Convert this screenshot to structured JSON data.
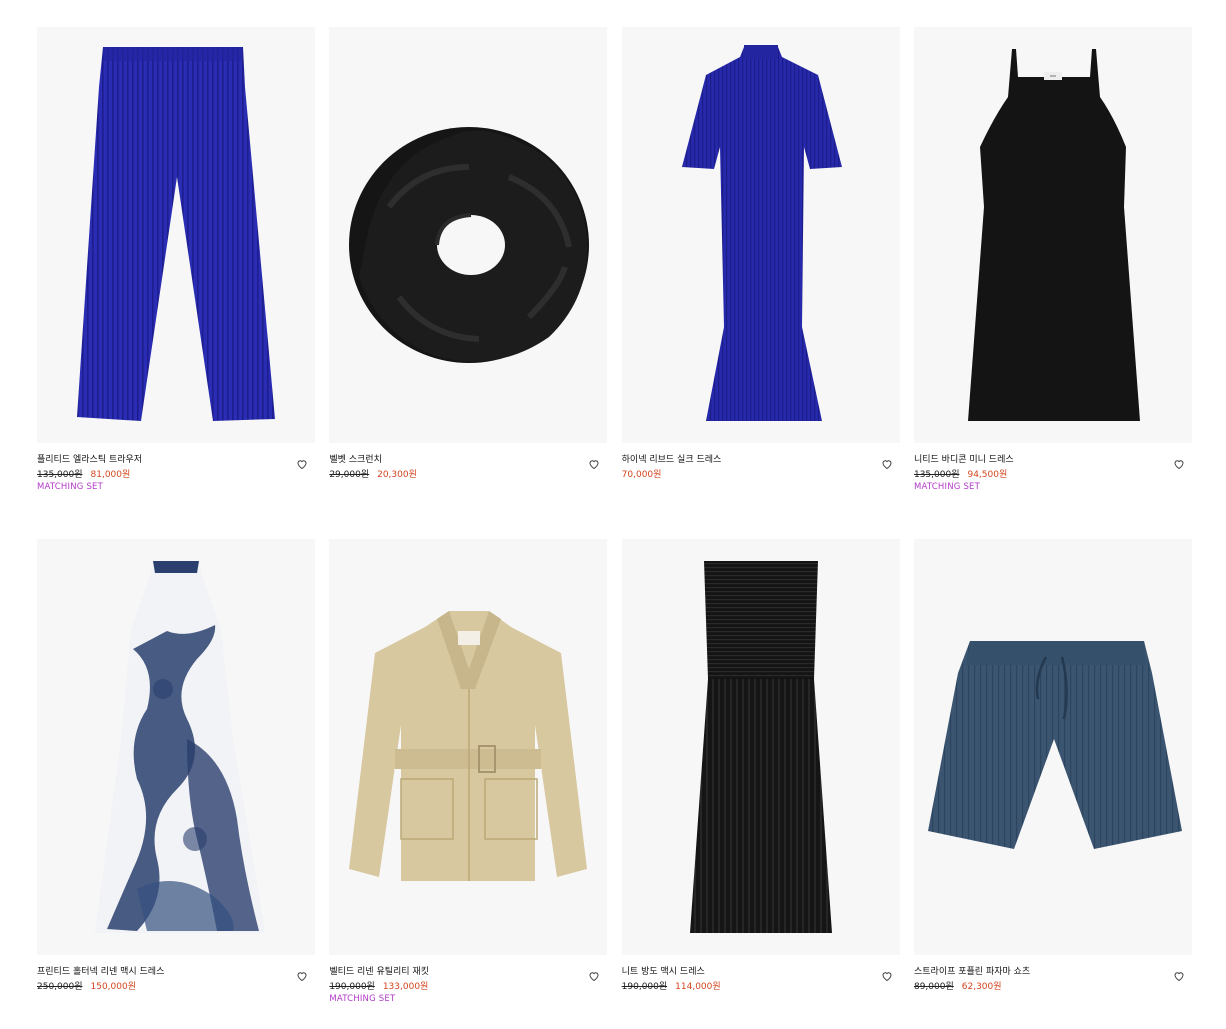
{
  "products": [
    {
      "name": "플리티드 엘라스틱 트라우저",
      "original_price": "135,000원",
      "price": "81,000원",
      "tag": "MATCHING SET",
      "image_icon": "trousers-image",
      "wishlist_icon": "heart-icon"
    },
    {
      "name": "벨벳 스크런치",
      "original_price": "29,000원",
      "price": "20,300원",
      "tag": "",
      "image_icon": "scrunchie-image",
      "wishlist_icon": "heart-icon"
    },
    {
      "name": "하이넥 리브드 실크 드레스",
      "original_price": "",
      "price": "70,000원",
      "tag": "",
      "image_icon": "dress-image",
      "wishlist_icon": "heart-icon"
    },
    {
      "name": "니티드 바디콘 미니 드레스",
      "original_price": "135,000원",
      "price": "94,500원",
      "tag": "MATCHING SET",
      "image_icon": "dress-image",
      "wishlist_icon": "heart-icon"
    },
    {
      "name": "프린티드 홀터넥 리넨 맥시 드레스",
      "original_price": "250,000원",
      "price": "150,000원",
      "tag": "",
      "image_icon": "dress-image",
      "wishlist_icon": "heart-icon"
    },
    {
      "name": "벨티드 리넨 유틸리티 재킷",
      "original_price": "190,000원",
      "price": "133,000원",
      "tag": "MATCHING SET",
      "image_icon": "jacket-image",
      "wishlist_icon": "heart-icon"
    },
    {
      "name": "니트 방도 맥시 드레스",
      "original_price": "190,000원",
      "price": "114,000원",
      "tag": "",
      "image_icon": "dress-image",
      "wishlist_icon": "heart-icon"
    },
    {
      "name": "스트라이프 포플린 파자마 쇼츠",
      "original_price": "89,000원",
      "price": "62,300원",
      "tag": "",
      "image_icon": "shorts-image",
      "wishlist_icon": "heart-icon"
    }
  ],
  "colors": {
    "image_background": "#f7f7f7",
    "sale_price": "#d4451f",
    "tag": "#b33ac8",
    "cobalt": "#2a2bb0",
    "black_garment": "#141414",
    "navy_print": "#2a3f6e",
    "beige": "#d8c8a0",
    "slate_blue": "#3b5571"
  }
}
